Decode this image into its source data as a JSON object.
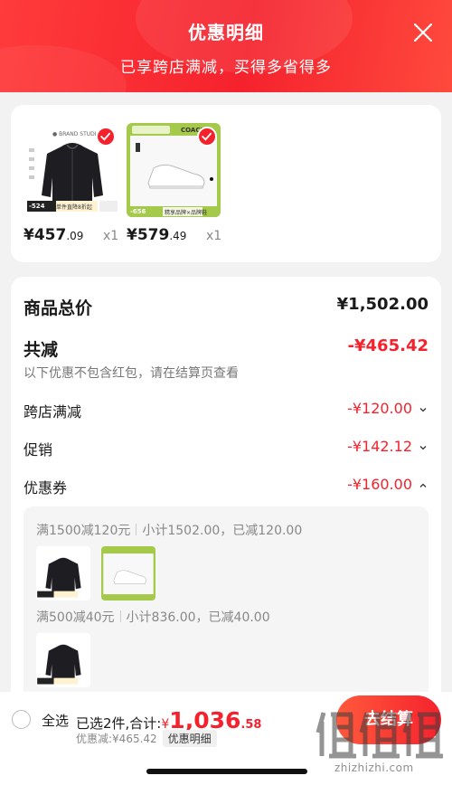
{
  "header": {
    "title": "优惠明细",
    "subtitle": "已享跨店满减，买得多省得多"
  },
  "products": [
    {
      "price_int": "¥457",
      "price_dec": ".09",
      "qty": "x1",
      "badge": "-524",
      "promo_text": "单件直降8折起",
      "brand": "BRAND STUDIO",
      "icon": "black-jacket-image"
    },
    {
      "price_int": "¥579",
      "price_dec": ".49",
      "qty": "x1",
      "badge": "-656",
      "promo_text": "精享品牌×品牌鞋",
      "brand": "COACH",
      "icon": "white-sneaker-image"
    }
  ],
  "summary": {
    "total_label": "商品总价",
    "total_value": "¥1,502.00",
    "minus_label": "共减",
    "minus_value": "-¥465.42",
    "note": "以下优惠不包含红包，请在结算页查看",
    "items": [
      {
        "label": "跨店满减",
        "value": "-¥120.00",
        "icon": "chevron-down-icon"
      },
      {
        "label": "促销",
        "value": "-¥142.12",
        "icon": "chevron-down-icon"
      },
      {
        "label": "优惠券",
        "value": "-¥160.00",
        "icon": "chevron-up-icon"
      }
    ]
  },
  "coupon_details": [
    {
      "rule": "满1500减120元",
      "detail": "小计1502.00，已减120.00"
    },
    {
      "rule": "满500减40元",
      "detail": "小计836.00，已减40.00"
    }
  ],
  "bottom": {
    "select_all": "全选",
    "selected_text": "已选2件,合计:",
    "currency": "¥",
    "amount_int": "1,036",
    "amount_dec": ".58",
    "discount_text": "优惠减:¥465.42",
    "detail_link": "优惠明细",
    "checkout": "去结算"
  },
  "watermark": {
    "signature": "值",
    "url": "zhizhizhi.com"
  },
  "colors": {
    "accent": "#f5222d",
    "header_gradient_start": "#ff3b3b",
    "coach_green": "#a5c94a"
  }
}
